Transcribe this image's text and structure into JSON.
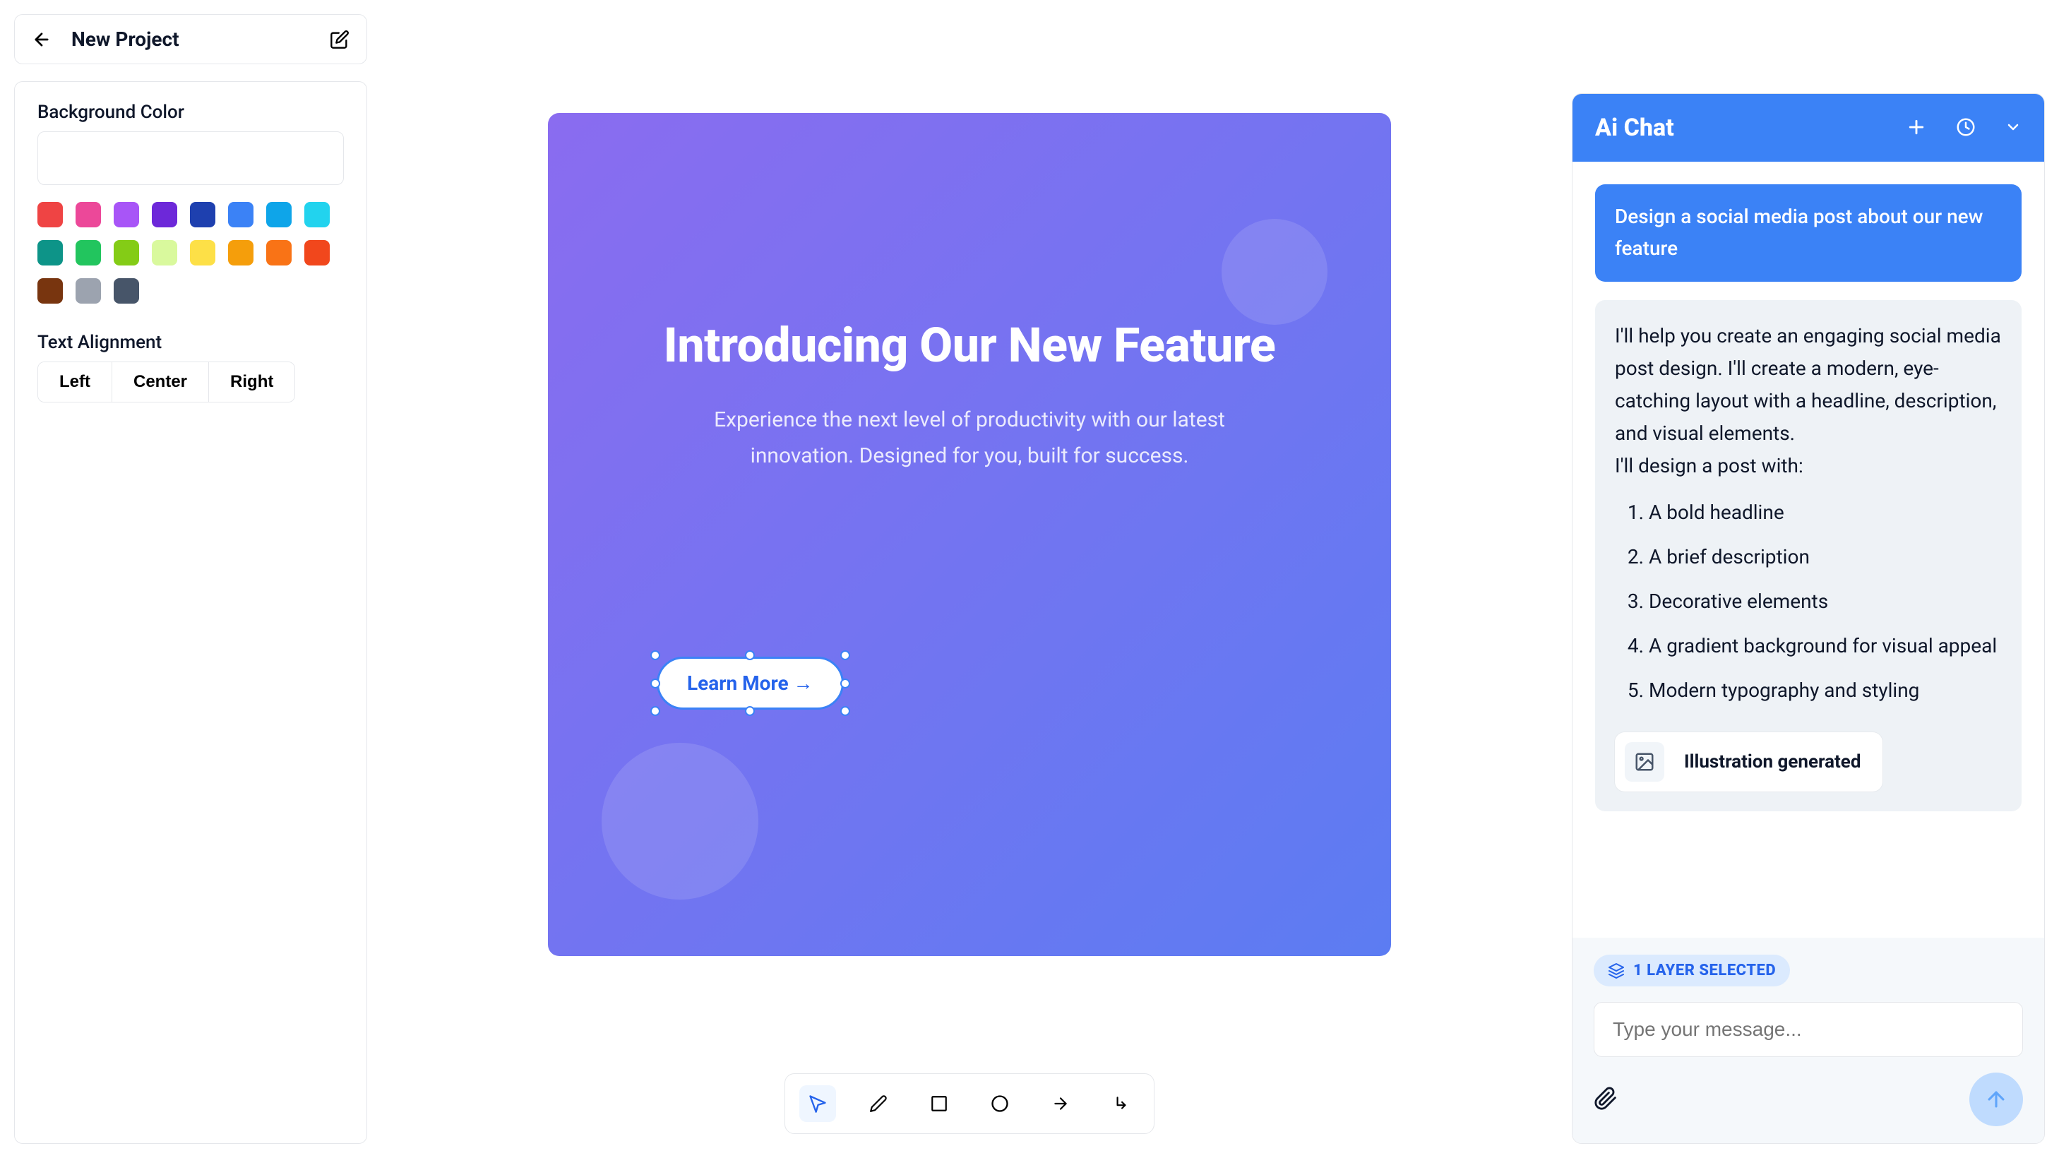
{
  "project": {
    "title": "New Project"
  },
  "props": {
    "bg_section_title": "Background Color",
    "colors": [
      "#ef4444",
      "#ec4899",
      "#a855f7",
      "#6d28d9",
      "#1e40af",
      "#3b82f6",
      "#0ea5e9",
      "#22d3ee",
      "#0d9488",
      "#22c55e",
      "#84cc16",
      "#d9f99d",
      "#fde047",
      "#f59e0b",
      "#f97316",
      "#f1471c",
      "#78350f",
      "#9ca3af",
      "#475569"
    ],
    "align_section_title": "Text Alignment",
    "align": {
      "left": "Left",
      "center": "Center",
      "right": "Right"
    }
  },
  "canvas": {
    "headline": "Introducing Our New Feature",
    "subhead": "Experience the next level of productivity with our latest innovation. Designed for you, built for success.",
    "cta": "Learn More →"
  },
  "toolbar": {
    "tools": [
      "cursor",
      "pencil",
      "rectangle",
      "circle",
      "arrow",
      "elbow-arrow"
    ],
    "active": "cursor"
  },
  "chat": {
    "title": "Ai Chat",
    "user_msg": "Design a social media post about our new feature",
    "ai_intro": "I'll help you create an engaging social media post design. I'll create a modern, eye-catching layout with a headline, description, and visual elements.",
    "ai_follow": "I'll design a post with:",
    "ai_items": [
      "A bold headline",
      "A brief description",
      "Decorative elements",
      "A gradient background for visual appeal",
      "Modern typography and styling"
    ],
    "gen_label": "Illustration generated",
    "layer_badge": "1 LAYER SELECTED",
    "input_placeholder": "Type your message..."
  }
}
